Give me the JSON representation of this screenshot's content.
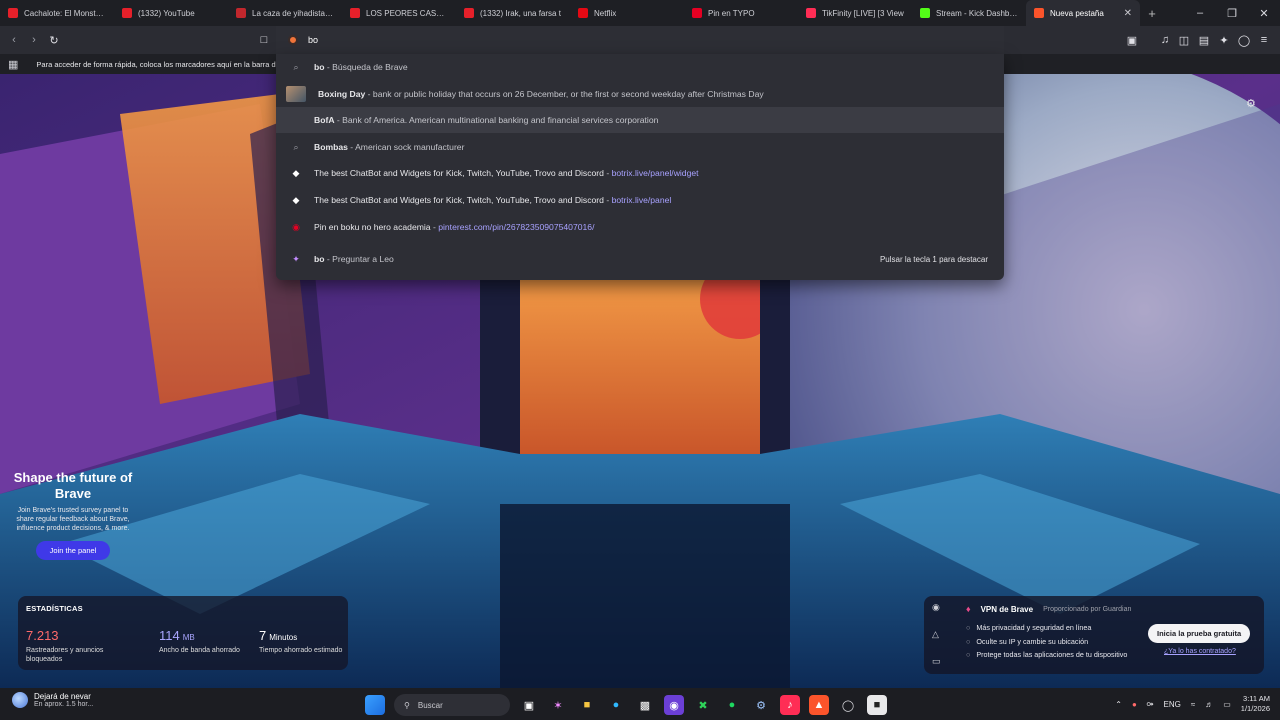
{
  "tabs": [
    {
      "title": "Cachalote: El Monstruo",
      "favColor": "#e6202a"
    },
    {
      "title": "(1332) YouTube",
      "favColor": "#e6202a"
    },
    {
      "title": "La caza de yihadistas e",
      "favColor": "#c1272d"
    },
    {
      "title": "LOS PEORES CASOS Ch",
      "favColor": "#e6202a"
    },
    {
      "title": "(1332) Irak, una farsa t",
      "favColor": "#e6202a"
    },
    {
      "title": "Netflix",
      "favColor": "#e50914"
    },
    {
      "title": "Pin en TYPO",
      "favColor": "#e60023"
    },
    {
      "title": "TikFinity [LIVE] [3 View",
      "favColor": "#ff2d55"
    },
    {
      "title": "Stream - Kick Dashboa",
      "favColor": "#53fc18"
    },
    {
      "title": "Nueva pestaña",
      "favColor": "#fb542b",
      "active": true
    }
  ],
  "omnibox": {
    "query": "bo"
  },
  "bookmarks_bar": {
    "text": "Para acceder de forma rápida, coloca los marcadores aquí en la barra de favoritos."
  },
  "dropdown": {
    "rows": [
      {
        "kind": "search",
        "bold": "bo",
        "desc": " - Búsqueda de Brave",
        "url": ""
      },
      {
        "kind": "thumb",
        "bold": "Boxing Day",
        "desc": " - bank or public holiday that occurs on 26 December, or the first or second weekday after Christmas Day",
        "url": ""
      },
      {
        "kind": "blank",
        "bold": "BofA",
        "desc": " - Bank of America. American multinational banking and financial services corporation",
        "url": ""
      },
      {
        "kind": "search",
        "bold": "Bombas",
        "desc": " - American sock manufacturer",
        "url": ""
      },
      {
        "kind": "bot",
        "bold": "The best ChatBot and Widgets for Kick, Twitch, YouTube, Trovo and Discord",
        "desc": " - ",
        "url": "botrix.live/panel/widget"
      },
      {
        "kind": "bot",
        "bold": "The best ChatBot and Widgets for Kick, Twitch, YouTube, Trovo and Discord",
        "desc": " - ",
        "url": "botrix.live/panel"
      },
      {
        "kind": "pin",
        "bold": "Pin en boku no hero academia",
        "desc": " - ",
        "url": "pinterest.com/pin/267823509075407016/"
      },
      {
        "kind": "leo",
        "bold": "bo",
        "desc": " - Preguntar a Leo",
        "url": ""
      }
    ],
    "hint": "Pulsar la tecla 1 para destacar"
  },
  "promo": {
    "title": "Shape the future of Brave",
    "subtitle": "Join Brave's trusted survey panel to share regular feedback about Brave, influence product decisions, & more.",
    "button": "Join the panel"
  },
  "stats": {
    "heading": "ESTADÍSTICAS",
    "items": [
      {
        "value": "7.213",
        "unit": "",
        "label": "Rastreadores y anuncios bloqueados",
        "color": "#ff6a6a"
      },
      {
        "value": "114",
        "unit": "MB",
        "label": "Ancho de banda ahorrado",
        "color": "#a9a6ff"
      },
      {
        "value": "7",
        "unit": "Minutos",
        "label": "Tiempo ahorrado estimado",
        "color": "#ffffff"
      }
    ]
  },
  "vpn": {
    "name": "VPN de Brave",
    "by": "Proporcionado por  Guardian",
    "features": [
      "Más privacidad y seguridad en línea",
      "Oculte su IP y cambie su ubicación",
      "Protege todas las aplicaciones de tu dispositivo"
    ],
    "cta": "Inicia la prueba gratuita",
    "already": "¿Ya lo has contratado?"
  },
  "taskbar": {
    "weather_title": "Dejará de nevar",
    "weather_sub": "En aprox. 1.5 hor...",
    "search_placeholder": "Buscar",
    "lang": "ENG",
    "time": "3:11 AM",
    "date": "1/1/2026"
  }
}
